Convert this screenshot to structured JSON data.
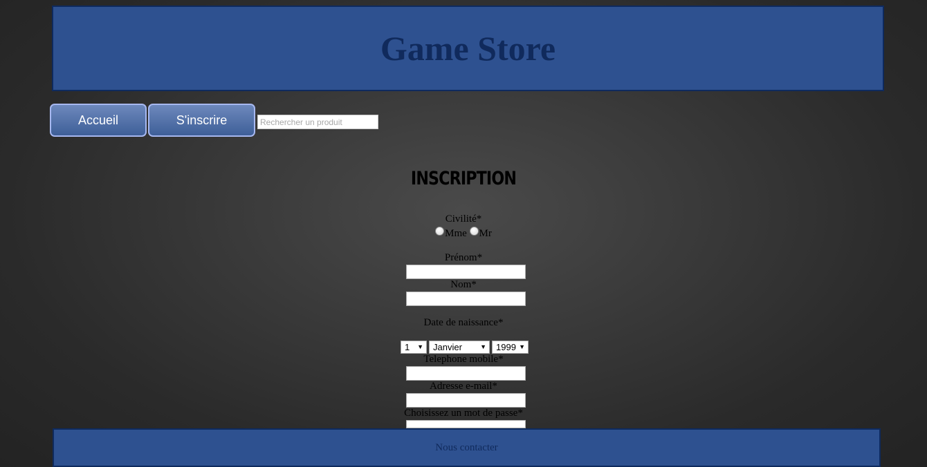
{
  "header": {
    "title": "Game Store"
  },
  "nav": {
    "home_label": "Accueil",
    "signup_label": "S'inscrire",
    "search_placeholder": "Rechercher un produit"
  },
  "form": {
    "title": "INSCRIPTION",
    "civility_label": "Civilité*",
    "civility_options": [
      "Mme",
      "Mr"
    ],
    "firstname_label": "Prénom*",
    "lastname_label": "Nom*",
    "birthdate_label": "Date de naissance*",
    "birth_day": "1",
    "birth_month": "Janvier",
    "birth_year": "1999",
    "phone_label": "Telephone mobile*",
    "email_label": "Adresse e-mail*",
    "password_label": "Choisissez un mot de passe*"
  },
  "footer": {
    "contact_label": "Nous contacter"
  },
  "colors": {
    "header_bg": "#2e5190",
    "header_text": "#102a5c",
    "button_gradient_top": "#6d88bc",
    "button_gradient_bottom": "#3e5f98",
    "button_border": "#a7b8f0"
  }
}
